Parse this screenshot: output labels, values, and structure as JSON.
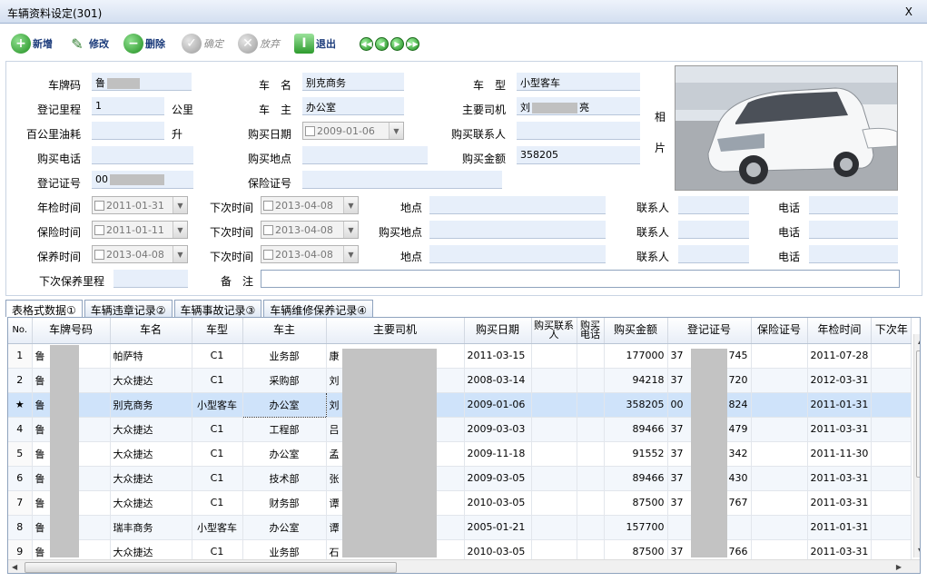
{
  "window": {
    "title": "车辆资料设定(301)",
    "close": "X"
  },
  "toolbar": {
    "add": "新增",
    "edit": "修改",
    "delete": "删除",
    "confirm": "确定",
    "discard": "放弃",
    "exit": "退出"
  },
  "form": {
    "plate_label": "车牌码",
    "plate_value": "鲁",
    "name_label": "车　名",
    "name_value": "别克商务",
    "type_label": "车　型",
    "type_value": "小型客车",
    "mileage_label": "登记里程",
    "mileage_value": "1",
    "mileage_unit": "公里",
    "owner_label": "车　主",
    "owner_value": "办公室",
    "driver_label": "主要司机",
    "driver_value_a": "刘",
    "driver_value_b": "亮",
    "fuel_label": "百公里油耗",
    "fuel_unit": "升",
    "buy_date_label": "购买日期",
    "buy_date_value": "2009-01-06",
    "buy_contact_label": "购买联系人",
    "buy_phone_label": "购买电话",
    "buy_place_label": "购买地点",
    "buy_amount_label": "购买金额",
    "buy_amount_value": "358205",
    "reg_no_label": "登记证号",
    "reg_no_value": "00",
    "insurance_no_label": "保险证号",
    "photo_label_1": "相",
    "photo_label_2": "片",
    "annual_label": "年检时间",
    "annual_value": "2011-01-31",
    "next_label": "下次时间",
    "next_annual_value": "2013-04-08",
    "place_label": "地点",
    "contact_label": "联系人",
    "phone_label": "电话",
    "insure_label": "保险时间",
    "insure_value": "2011-01-11",
    "next_insure_value": "2013-04-08",
    "insure_place_label": "购买地点",
    "maint_label": "保养时间",
    "maint_value": "2013-04-08",
    "next_maint_value": "2013-04-08",
    "next_maint_mileage_label": "下次保养里程",
    "remark_label": "备　注"
  },
  "tabs": [
    "表格式数据①",
    "车辆违章记录②",
    "车辆事故记录③",
    "车辆维修保养记录④"
  ],
  "grid": {
    "headers": [
      "No.",
      "车牌号码",
      "车名",
      "车型",
      "车主",
      "主要司机",
      "购买日期",
      "购买联系人",
      "购买电话",
      "购买金额",
      "登记证号",
      "保险证号",
      "年检时间",
      "下次年"
    ],
    "rows": [
      {
        "no": "1",
        "plate": "鲁",
        "name": "帕萨特",
        "type": "C1",
        "owner": "业务部",
        "driver": "康",
        "date": "2011-03-15",
        "amount": "177000",
        "reg_a": "37",
        "reg_b": "745",
        "annual": "2011-07-28"
      },
      {
        "no": "2",
        "plate": "鲁",
        "name": "大众捷达",
        "type": "C1",
        "owner": "采购部",
        "driver": "刘",
        "date": "2008-03-14",
        "amount": "94218",
        "reg_a": "37",
        "reg_b": "720",
        "annual": "2012-03-31"
      },
      {
        "no": "★",
        "plate": "鲁",
        "name": "别克商务",
        "type": "小型客车",
        "owner": "办公室",
        "driver": "刘",
        "date": "2009-01-06",
        "amount": "358205",
        "reg_a": "00",
        "reg_b": "824",
        "annual": "2011-01-31"
      },
      {
        "no": "4",
        "plate": "鲁",
        "name": "大众捷达",
        "type": "C1",
        "owner": "工程部",
        "driver": "吕",
        "date": "2009-03-03",
        "amount": "89466",
        "reg_a": "37",
        "reg_b": "479",
        "annual": "2011-03-31"
      },
      {
        "no": "5",
        "plate": "鲁",
        "name": "大众捷达",
        "type": "C1",
        "owner": "办公室",
        "driver": "孟",
        "date": "2009-11-18",
        "amount": "91552",
        "reg_a": "37",
        "reg_b": "342",
        "annual": "2011-11-30"
      },
      {
        "no": "6",
        "plate": "鲁",
        "name": "大众捷达",
        "type": "C1",
        "owner": "技术部",
        "driver": "张",
        "date": "2009-03-05",
        "amount": "89466",
        "reg_a": "37",
        "reg_b": "430",
        "annual": "2011-03-31"
      },
      {
        "no": "7",
        "plate": "鲁",
        "name": "大众捷达",
        "type": "C1",
        "owner": "财务部",
        "driver": "谭",
        "date": "2010-03-05",
        "amount": "87500",
        "reg_a": "37",
        "reg_b": "767",
        "annual": "2011-03-31"
      },
      {
        "no": "8",
        "plate": "鲁",
        "name": "瑞丰商务",
        "type": "小型客车",
        "owner": "办公室",
        "driver": "谭",
        "date": "2005-01-21",
        "amount": "157700",
        "reg_a": "",
        "reg_b": "",
        "annual": "2011-01-31"
      },
      {
        "no": "9",
        "plate": "鲁",
        "name": "大众捷达",
        "type": "C1",
        "owner": "业务部",
        "driver": "石",
        "date": "2010-03-05",
        "amount": "87500",
        "reg_a": "37",
        "reg_b": "766",
        "annual": "2011-03-31"
      }
    ]
  }
}
